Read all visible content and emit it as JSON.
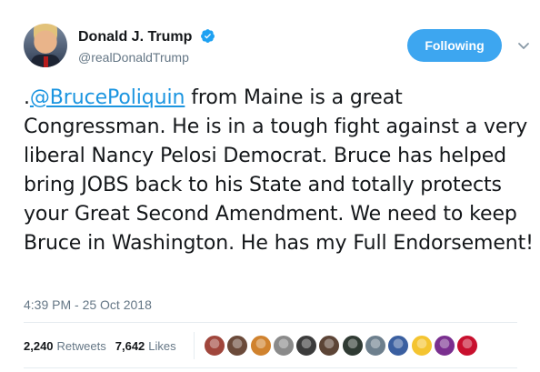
{
  "user": {
    "display_name": "Donald J. Trump",
    "handle": "@realDonaldTrump",
    "verified": true,
    "avatar_icon": "profile-photo"
  },
  "follow_button": {
    "label": "Following"
  },
  "menu": {
    "icon": "chevron-down-icon"
  },
  "tweet": {
    "prefix": ".",
    "mention": "@BrucePoliquin",
    "body": " from Maine is a great Congressman. He is in a tough fight against a very liberal Nancy Pelosi Democrat. Bruce has helped bring JOBS back to his State and totally protects your Great Second Amendment. We need to keep Bruce in Washington. He has my Full Endorsement!",
    "timestamp": "4:39 PM - 25 Oct 2018"
  },
  "stats": {
    "retweets_count": "2,240",
    "retweets_label": "Retweets",
    "likes_count": "7,642",
    "likes_label": "Likes"
  },
  "colors": {
    "accent": "#1b95e0",
    "follow_bg": "#3da6f0",
    "secondary_text": "#657786"
  },
  "likers": [
    {
      "color": "#a0463c"
    },
    {
      "color": "#6b4a3a"
    },
    {
      "color": "#d0822e"
    },
    {
      "color": "#8a8a8a"
    },
    {
      "color": "#3b3b3b"
    },
    {
      "color": "#5c4436"
    },
    {
      "color": "#2f3a33"
    },
    {
      "color": "#6d7f8d"
    },
    {
      "color": "#3a5fa0"
    },
    {
      "color": "#f4c430"
    },
    {
      "color": "#7a2f8f"
    },
    {
      "color": "#c8102e"
    }
  ]
}
